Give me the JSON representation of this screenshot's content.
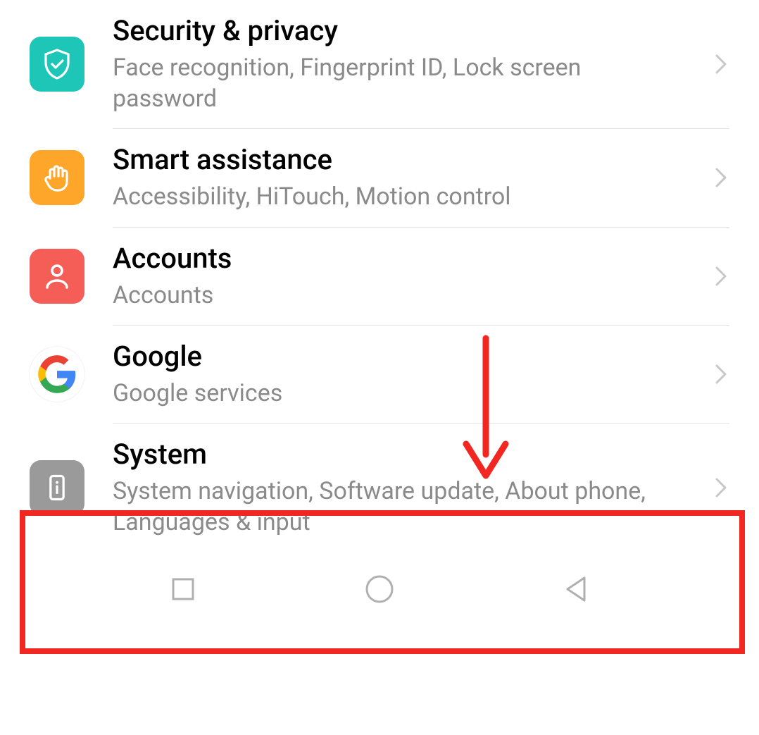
{
  "settings": {
    "items": [
      {
        "id": "security",
        "title": "Security & privacy",
        "subtitle": "Face recognition, Fingerprint ID, Lock screen password",
        "icon": "shield-check",
        "icon_bg": "#1dc6b6"
      },
      {
        "id": "smart",
        "title": "Smart assistance",
        "subtitle": "Accessibility, HiTouch, Motion control",
        "icon": "hand",
        "icon_bg": "#fea629"
      },
      {
        "id": "accounts",
        "title": "Accounts",
        "subtitle": "Accounts",
        "icon": "person",
        "icon_bg": "#f55d57"
      },
      {
        "id": "google",
        "title": "Google",
        "subtitle": "Google services",
        "icon": "google-g",
        "icon_bg": "#ffffff"
      },
      {
        "id": "system",
        "title": "System",
        "subtitle": "System navigation, Software update, About phone, Languages & input",
        "icon": "phone-info",
        "icon_bg": "#9a9a9a"
      }
    ]
  },
  "annotation": {
    "highlighted_item": "system",
    "arrow_color": "#f32722"
  },
  "nav": {
    "recent": "recent-apps",
    "home": "home",
    "back": "back"
  }
}
